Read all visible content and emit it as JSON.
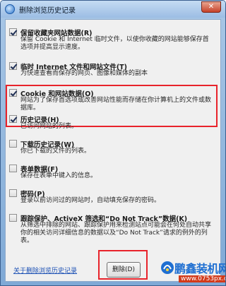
{
  "window": {
    "title": "删除浏览历史记录",
    "close_label": "✕"
  },
  "options": [
    {
      "checked": true,
      "title": "保留收藏夹网站数据(R)",
      "desc": "保留 Cookie 和 Internet 临时文件，以使你收藏的网站能够保存首选项并提高显示速度。"
    },
    {
      "checked": true,
      "title": "临时 Internet 文件和网站文件(T)",
      "desc": "为快速查看而保存的网页、图像和媒体的副本"
    },
    {
      "checked": true,
      "title": "Cookie 和网站数据(O)",
      "desc": "网站为了保存首选项或改善网站性能而存储在你计算机上的文件或数据库。"
    },
    {
      "checked": true,
      "title": "历史记录(H)",
      "desc": "已访问网站的列表。"
    },
    {
      "checked": false,
      "title": "下载历史记录(W)",
      "desc": "你已下载的文件的列表。"
    },
    {
      "checked": false,
      "title": "表单数据(F)",
      "desc": "保存在表单中键入的信息。"
    },
    {
      "checked": false,
      "title": "密码(P)",
      "desc": "登录以前访问过的网站时，自动填充保存的密码。"
    },
    {
      "checked": false,
      "title": "跟踪保护、ActiveX 筛选和“Do Not Track”数据(K)",
      "desc": "从筛选中排除的网站、跟踪保护用来检测站点可能会在何处自动共享你的相关访问详细信息的数据以及“Do Not Track”请求的例外的列表。"
    }
  ],
  "footer": {
    "link_label": "关于删除浏览历史记录",
    "delete_label": "删除(D)"
  },
  "watermark": {
    "title": "鹏鑫装机网",
    "url": "www.0753px.com"
  }
}
